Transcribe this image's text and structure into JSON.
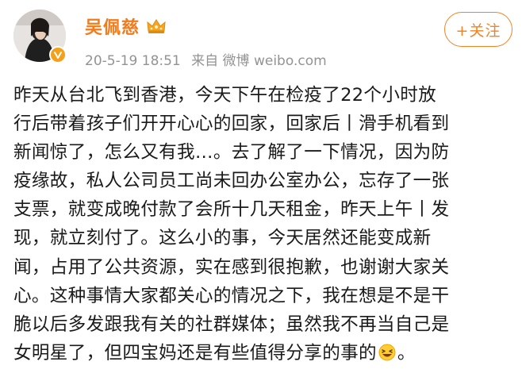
{
  "post": {
    "username": "吴佩慈",
    "timestamp": "20-5-19 18:51",
    "source": "来自 微博 weibo.com",
    "follow_label": "+关注",
    "icons": {
      "avatar": "avatar",
      "verified": "verified-badge-icon",
      "member_crown": "crown-icon",
      "emoji": "laughing-emoji-icon"
    },
    "colors": {
      "username": "#f07c1e",
      "accent": "#f38321",
      "meta": "#939393",
      "body_text": "#1a1a1a"
    },
    "body_lines": [
      "昨天从台北飞到香港，今天下午在检疫了22个小时放",
      "行后带着孩子们开开心心的回家，回家后丨滑手机看到",
      "新闻惊了，怎么又有我…。去了解了一下情况，因为防",
      "疫缘故，私人公司员工尚未回办公室办公，忘存了一张",
      "支票，就变成晚付款了会所十几天租金，昨天上午丨发",
      "现，就立刻付了。这么小的事，今天居然还能变成新",
      "闻，占用了公共资源，实在感到很抱歉，也谢谢大家关",
      "心。这种事情大家都关心的情况之下，我在想是不是干",
      "脆以后多发跟我有关的社群媒体；虽然我不再当自己是",
      "女明星了，但四宝妈还是有些值得分享的事的"
    ],
    "body_end": "。"
  }
}
